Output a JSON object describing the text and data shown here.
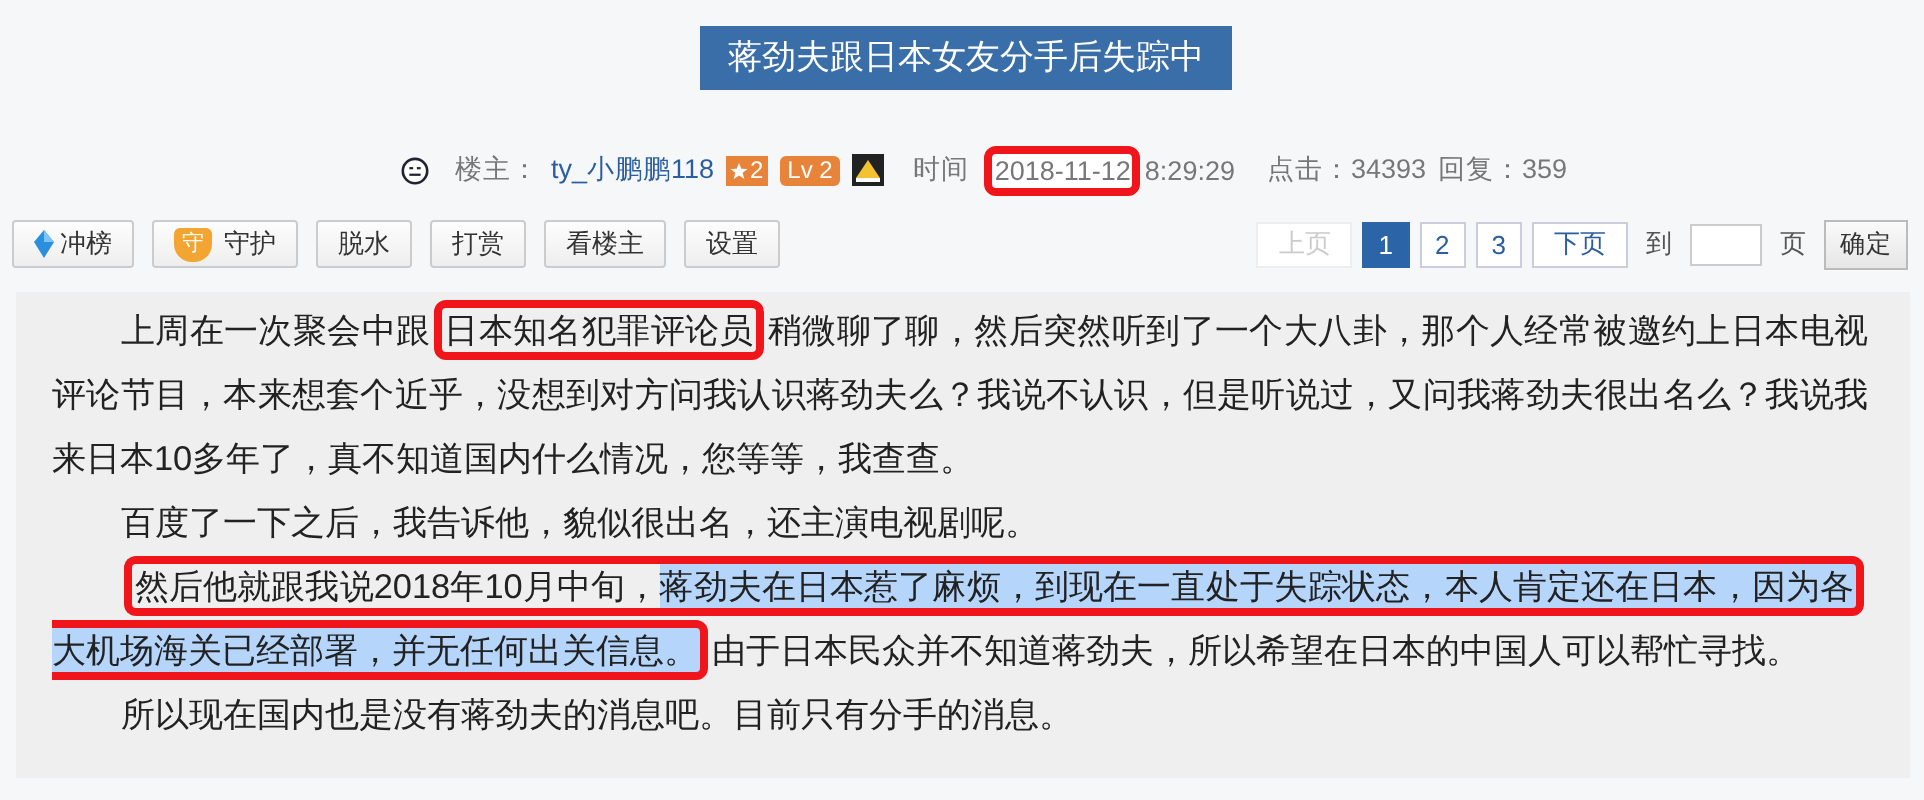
{
  "title": "蒋劲夫跟日本女友分手后失踪中",
  "meta": {
    "owner_label": "楼主：",
    "owner": "ty_小鹏鹏118",
    "star_badge": "2",
    "level_badge": "Lv 2",
    "time_label": "时间",
    "date": "2018-11-12",
    "date_boxed": true,
    "time": "8:29:29",
    "clicks": "点击：34393",
    "replies": "回复：359"
  },
  "toolbar": [
    {
      "label": "冲榜",
      "kind": "diamond"
    },
    {
      "label": "守护",
      "kind": "shield",
      "badge": "守"
    },
    {
      "label": "脱水",
      "kind": "plain"
    },
    {
      "label": "打赏",
      "kind": "plain"
    },
    {
      "label": "看楼主",
      "kind": "plain"
    },
    {
      "label": "设置",
      "kind": "plain"
    }
  ],
  "pager": {
    "prev": {
      "label": "上页",
      "disabled": true
    },
    "pages": [
      {
        "label": "1",
        "selected": true
      },
      {
        "label": "2",
        "selected": false
      },
      {
        "label": "3",
        "selected": false
      }
    ],
    "next": {
      "label": "下页",
      "disabled": false
    },
    "goto_label": "到",
    "page_label": "页",
    "confirm": "确定"
  },
  "paragraphs": [
    {
      "segments": [
        {
          "text": "上周在一次聚会中跟",
          "boxed": false,
          "selected": false
        },
        {
          "text": "日本知名犯罪评论员",
          "boxed": true,
          "selected": false
        },
        {
          "text": "稍微聊了聊，然后突然听到了一个大八卦，那个人经常被邀约上日本电视评论节目，本来想套个近乎，没想到对方问我认识蒋劲夫么？我说不认识，但是听说过，又问我蒋劲夫很出名么？我说我来日本10多年了，真不知道国内什么情况，您等等，我查查。",
          "boxed": false,
          "selected": false
        }
      ]
    },
    {
      "segments": [
        {
          "text": "百度了一下之后，我告诉他，貌似很出名，还主演电视剧呢。",
          "boxed": false,
          "selected": false
        }
      ]
    },
    {
      "segments": [
        {
          "text": "然后他就跟我说2018年10月中旬，",
          "boxed": true,
          "selected": false
        },
        {
          "text": "蒋劲夫在日本惹了麻烦，到现在一直处于失踪状态，本人肯定还在日本，因为各大机场海关已经部署，并无任何出关信息。",
          "boxed": true,
          "selected": true
        },
        {
          "text": "由于日本民众并不知道蒋劲夫，所以希望在日本的中国人可以帮忙寻找。",
          "boxed": false,
          "selected": false
        }
      ]
    },
    {
      "segments": [
        {
          "text": "所以现在国内也是没有蒋劲夫的消息吧。目前只有分手的消息。",
          "boxed": false,
          "selected": false
        }
      ]
    }
  ]
}
